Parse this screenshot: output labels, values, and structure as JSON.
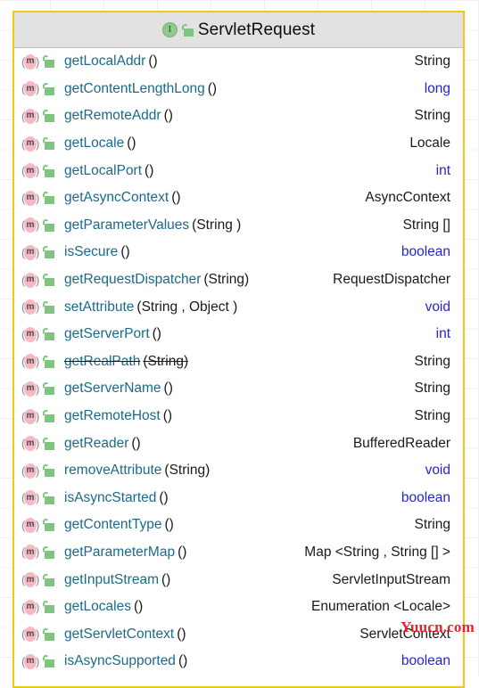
{
  "popup": {
    "header": {
      "icon": "interface-icon",
      "icon_letter": "I",
      "modifier_icon": "public-modifier-icon",
      "title": "ServletRequest"
    },
    "accent_color": "#f5c518",
    "header_bg": "#e2e2e2",
    "method_name_color": "#1b6a8c",
    "primitive_type_color": "#2424d6",
    "object_type_color": "#1a1a1a",
    "members": [
      {
        "icon": "method-icon",
        "icon_letter": "m",
        "modifier_icon": "public-modifier-icon",
        "name": "getLocalAddr",
        "params": "()",
        "type": "String",
        "primitive": false,
        "deprecated": false
      },
      {
        "icon": "method-icon",
        "icon_letter": "m",
        "modifier_icon": "public-modifier-icon",
        "name": "getContentLengthLong",
        "params": "()",
        "type": "long",
        "primitive": true,
        "deprecated": false
      },
      {
        "icon": "method-icon",
        "icon_letter": "m",
        "modifier_icon": "public-modifier-icon",
        "name": "getRemoteAddr",
        "params": "()",
        "type": "String",
        "primitive": false,
        "deprecated": false
      },
      {
        "icon": "method-icon",
        "icon_letter": "m",
        "modifier_icon": "public-modifier-icon",
        "name": "getLocale",
        "params": "()",
        "type": "Locale",
        "primitive": false,
        "deprecated": false
      },
      {
        "icon": "method-icon",
        "icon_letter": "m",
        "modifier_icon": "public-modifier-icon",
        "name": "getLocalPort",
        "params": "()",
        "type": "int",
        "primitive": true,
        "deprecated": false
      },
      {
        "icon": "method-icon",
        "icon_letter": "m",
        "modifier_icon": "public-modifier-icon",
        "name": "getAsyncContext",
        "params": "()",
        "type": "AsyncContext",
        "primitive": false,
        "deprecated": false
      },
      {
        "icon": "method-icon",
        "icon_letter": "m",
        "modifier_icon": "public-modifier-icon",
        "name": "getParameterValues",
        "params": "(String )",
        "type": "String []",
        "primitive": false,
        "deprecated": false
      },
      {
        "icon": "method-icon",
        "icon_letter": "m",
        "modifier_icon": "public-modifier-icon",
        "name": "isSecure",
        "params": "()",
        "type": "boolean",
        "primitive": true,
        "deprecated": false
      },
      {
        "icon": "method-icon",
        "icon_letter": "m",
        "modifier_icon": "public-modifier-icon",
        "name": "getRequestDispatcher",
        "params": "(String)",
        "type": "RequestDispatcher",
        "primitive": false,
        "deprecated": false
      },
      {
        "icon": "method-icon",
        "icon_letter": "m",
        "modifier_icon": "public-modifier-icon",
        "name": "setAttribute",
        "params": "(String , Object )",
        "type": "void",
        "primitive": true,
        "deprecated": false
      },
      {
        "icon": "method-icon",
        "icon_letter": "m",
        "modifier_icon": "public-modifier-icon",
        "name": "getServerPort",
        "params": "()",
        "type": "int",
        "primitive": true,
        "deprecated": false
      },
      {
        "icon": "method-icon",
        "icon_letter": "m",
        "modifier_icon": "public-modifier-icon",
        "name": "getRealPath",
        "params": "(String)",
        "type": "String",
        "primitive": false,
        "deprecated": true
      },
      {
        "icon": "method-icon",
        "icon_letter": "m",
        "modifier_icon": "public-modifier-icon",
        "name": "getServerName",
        "params": "()",
        "type": "String",
        "primitive": false,
        "deprecated": false
      },
      {
        "icon": "method-icon",
        "icon_letter": "m",
        "modifier_icon": "public-modifier-icon",
        "name": "getRemoteHost",
        "params": "()",
        "type": "String",
        "primitive": false,
        "deprecated": false
      },
      {
        "icon": "method-icon",
        "icon_letter": "m",
        "modifier_icon": "public-modifier-icon",
        "name": "getReader",
        "params": "()",
        "type": "BufferedReader",
        "primitive": false,
        "deprecated": false
      },
      {
        "icon": "method-icon",
        "icon_letter": "m",
        "modifier_icon": "public-modifier-icon",
        "name": "removeAttribute",
        "params": "(String)",
        "type": "void",
        "primitive": true,
        "deprecated": false
      },
      {
        "icon": "method-icon",
        "icon_letter": "m",
        "modifier_icon": "public-modifier-icon",
        "name": "isAsyncStarted",
        "params": "()",
        "type": "boolean",
        "primitive": true,
        "deprecated": false
      },
      {
        "icon": "method-icon",
        "icon_letter": "m",
        "modifier_icon": "public-modifier-icon",
        "name": "getContentType",
        "params": "()",
        "type": "String",
        "primitive": false,
        "deprecated": false
      },
      {
        "icon": "method-icon",
        "icon_letter": "m",
        "modifier_icon": "public-modifier-icon",
        "name": "getParameterMap",
        "params": "()",
        "type": "Map <String , String [] >",
        "primitive": false,
        "deprecated": false
      },
      {
        "icon": "method-icon",
        "icon_letter": "m",
        "modifier_icon": "public-modifier-icon",
        "name": "getInputStream",
        "params": "()",
        "type": "ServletInputStream",
        "primitive": false,
        "deprecated": false
      },
      {
        "icon": "method-icon",
        "icon_letter": "m",
        "modifier_icon": "public-modifier-icon",
        "name": "getLocales",
        "params": "()",
        "type": "Enumeration <Locale>",
        "primitive": false,
        "deprecated": false
      },
      {
        "icon": "method-icon",
        "icon_letter": "m",
        "modifier_icon": "public-modifier-icon",
        "name": "getServletContext",
        "params": "()",
        "type": "ServletContext",
        "primitive": false,
        "deprecated": false
      },
      {
        "icon": "method-icon",
        "icon_letter": "m",
        "modifier_icon": "public-modifier-icon",
        "name": "isAsyncSupported",
        "params": "()",
        "type": "boolean",
        "primitive": true,
        "deprecated": false
      }
    ]
  },
  "watermark": {
    "text": "Yuucn.com",
    "color": "#e8222a"
  }
}
